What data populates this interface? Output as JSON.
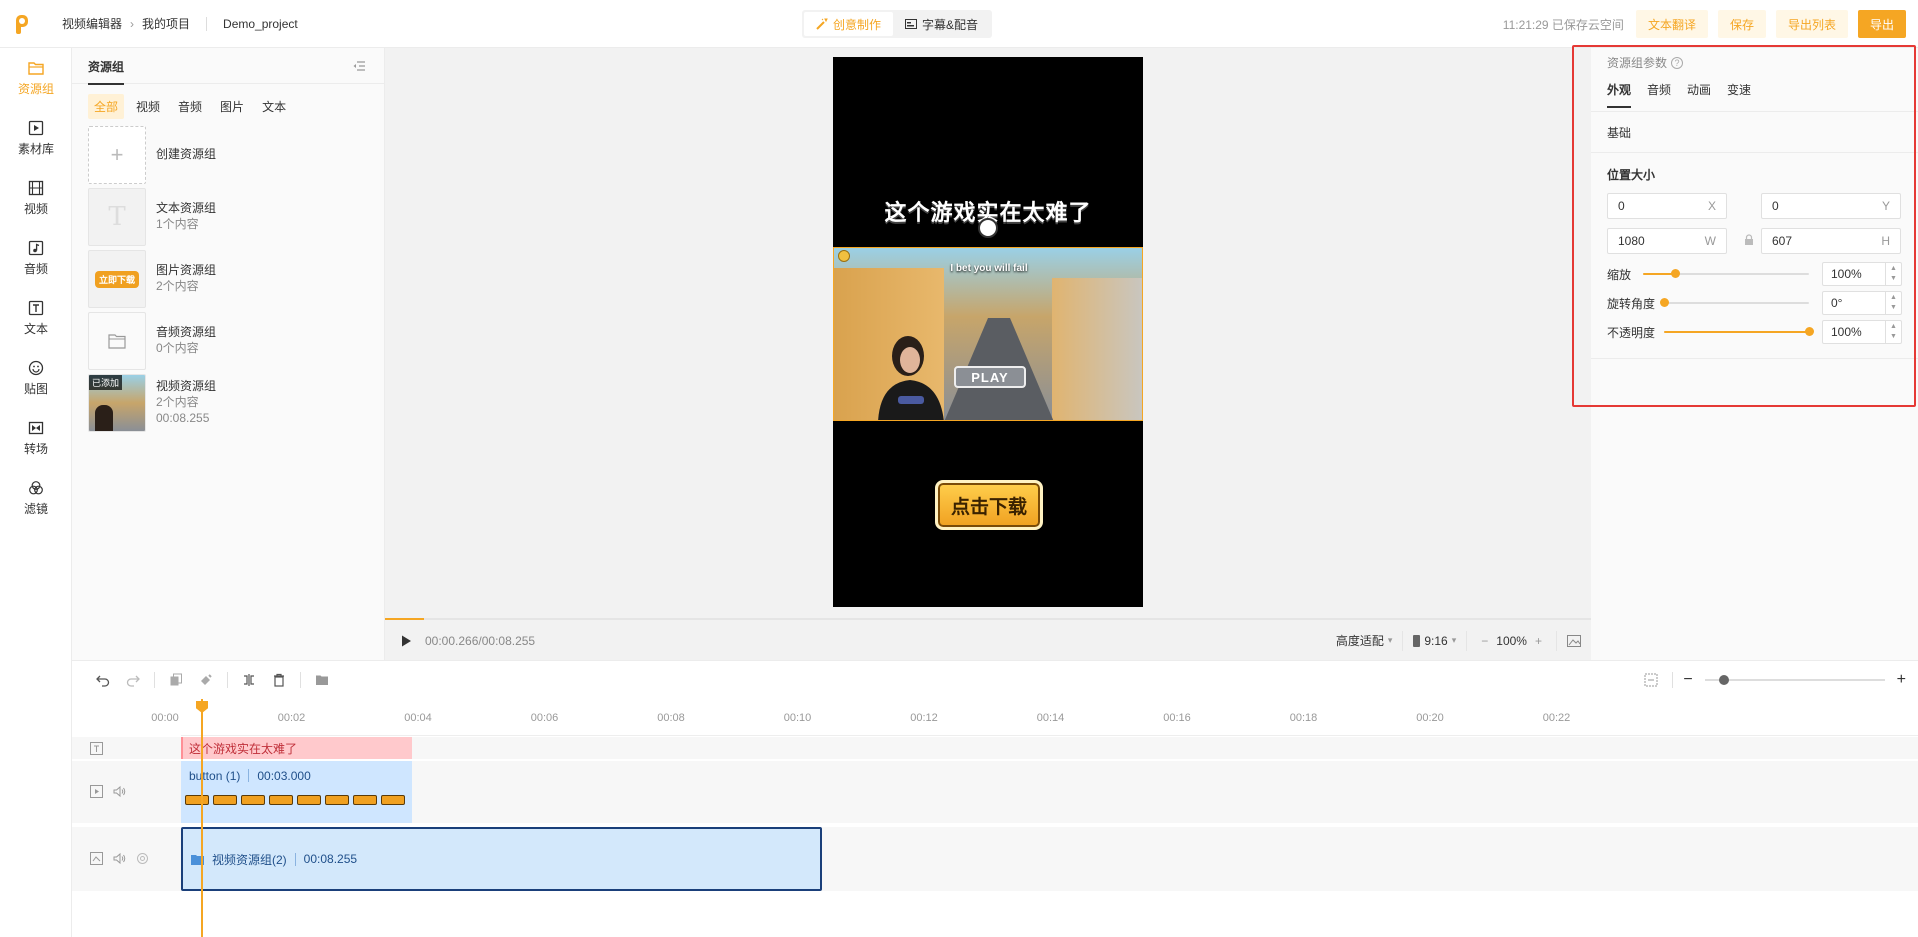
{
  "topbar": {
    "breadcrumb": [
      "视频编辑器",
      "我的项目"
    ],
    "project_name": "Demo_project",
    "modes": [
      {
        "label": "创意制作",
        "active": true
      },
      {
        "label": "字幕&配音",
        "active": false
      }
    ],
    "save_status": "11:21:29 已保存云空间",
    "translate_label": "文本翻译",
    "save_label": "保存",
    "export_list_label": "导出列表",
    "export_label": "导出"
  },
  "rail": [
    {
      "label": "资源组",
      "icon": "folder-icon",
      "active": true
    },
    {
      "label": "素材库",
      "icon": "media-library-icon",
      "active": false
    },
    {
      "label": "视频",
      "icon": "film-icon",
      "active": false
    },
    {
      "label": "音频",
      "icon": "music-icon",
      "active": false
    },
    {
      "label": "文本",
      "icon": "text-icon",
      "active": false
    },
    {
      "label": "贴图",
      "icon": "sticker-icon",
      "active": false
    },
    {
      "label": "转场",
      "icon": "transition-icon",
      "active": false
    },
    {
      "label": "滤镜",
      "icon": "filter-icon",
      "active": false
    }
  ],
  "resources": {
    "title": "资源组",
    "tabs": [
      "全部",
      "视频",
      "音频",
      "图片",
      "文本"
    ],
    "active_tab": "全部",
    "create_label": "创建资源组",
    "groups": [
      {
        "name": "文本资源组",
        "count": "1个内容",
        "thumb_letter": "T"
      },
      {
        "name": "图片资源组",
        "count": "2个内容",
        "thumb_badge": "立即下载"
      },
      {
        "name": "音频资源组",
        "count": "0个内容"
      },
      {
        "name": "视频资源组",
        "count": "2个内容",
        "duration": "00:08.255",
        "thumb_badge": "已添加"
      }
    ]
  },
  "preview": {
    "overlay_title": "这个游戏实在太难了",
    "video_caption": "I bet you will fail",
    "play_button": "PLAY",
    "download_button": "点击下载",
    "time": "00:00.266/00:08.255",
    "progress": 0.032,
    "fit_mode": "高度适配",
    "ratio": "9:16",
    "zoom": "100%",
    "zoom_minus": "−",
    "zoom_plus": "+"
  },
  "params": {
    "title": "资源组参数",
    "tabs": [
      "外观",
      "音频",
      "动画",
      "变速"
    ],
    "active_tab": "外观",
    "section_basic": "基础",
    "section_position": "位置大小",
    "x": "0",
    "x_unit": "X",
    "y": "0",
    "y_unit": "Y",
    "w": "1080",
    "w_unit": "W",
    "h": "607",
    "h_unit": "H",
    "scale_label": "缩放",
    "scale_value": "100%",
    "scale_level": 0.19,
    "rotate_label": "旋转角度",
    "rotate_value": "0°",
    "rotate_level": 0.0,
    "opacity_label": "不透明度",
    "opacity_value": "100%",
    "opacity_level": 1.0
  },
  "timeline": {
    "ticks": [
      "00:00",
      "00:02",
      "00:04",
      "00:06",
      "00:08",
      "00:10",
      "00:12",
      "00:14",
      "00:16",
      "00:18",
      "00:20",
      "00:22"
    ],
    "text_clip": "这个游戏实在太难了",
    "button_clip_name": "button (1)",
    "button_clip_duration": "00:03.000",
    "video_clip_name": "视频资源组(2)",
    "video_clip_duration": "00:08.255",
    "zoom_minus": "−",
    "zoom_plus": "+"
  },
  "colors": {
    "accent": "#f5a623",
    "highlight": "#e53935"
  }
}
